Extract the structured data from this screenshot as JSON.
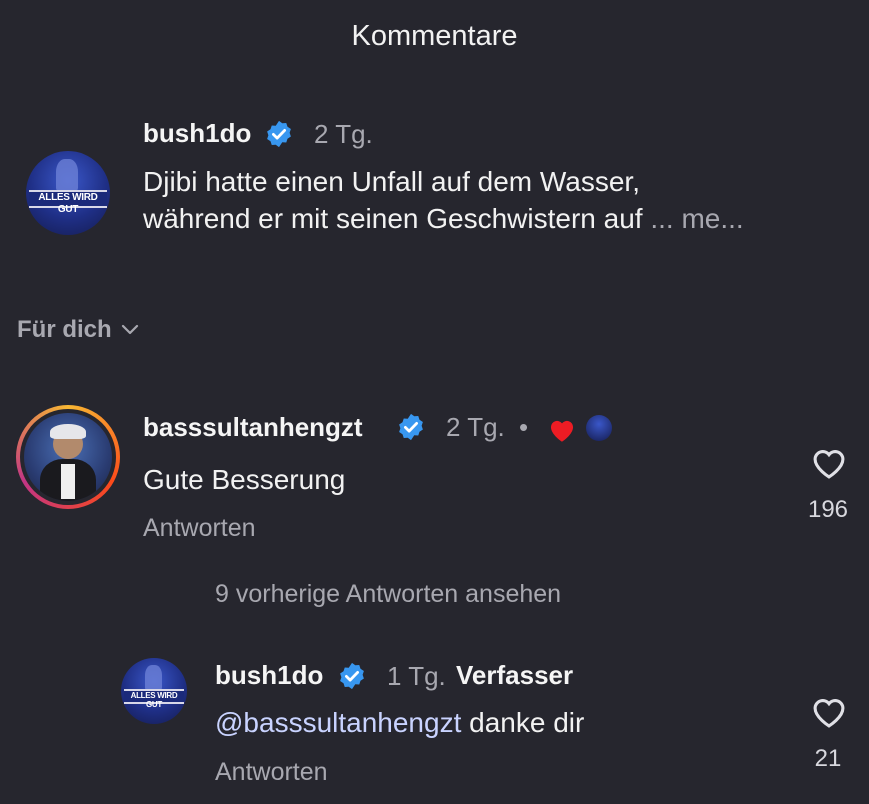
{
  "header": {
    "title": "Kommentare"
  },
  "post": {
    "username": "bush1do",
    "time": "2 Tg.",
    "avatar_banner": "ALLES WIRD GUT",
    "caption_line1": "Djibi hatte einen Unfall auf dem Wasser,",
    "caption_line2": "während er mit seinen Geschwistern auf",
    "more_label": "... me..."
  },
  "filter": {
    "label": "Für dich"
  },
  "comments": [
    {
      "username": "basssultanhengzt",
      "time": "2 Tg.",
      "separator": "•",
      "text": "Gute Besserung",
      "reply_label": "Antworten",
      "likes": "196"
    }
  ],
  "view_replies": {
    "label": "9 vorherige Antworten ansehen"
  },
  "reply": {
    "username": "bush1do",
    "time": "1 Tg.",
    "author_tag": "Verfasser",
    "mention": "@basssultanhengzt",
    "text": " danke dir",
    "reply_label": "Antworten",
    "likes": "21",
    "avatar_banner": "ALLES WIRD GUT"
  },
  "colors": {
    "background": "#26262e",
    "verified": "#3897f0",
    "heart_red": "#ed1c24",
    "muted": "#a8a8b0"
  }
}
